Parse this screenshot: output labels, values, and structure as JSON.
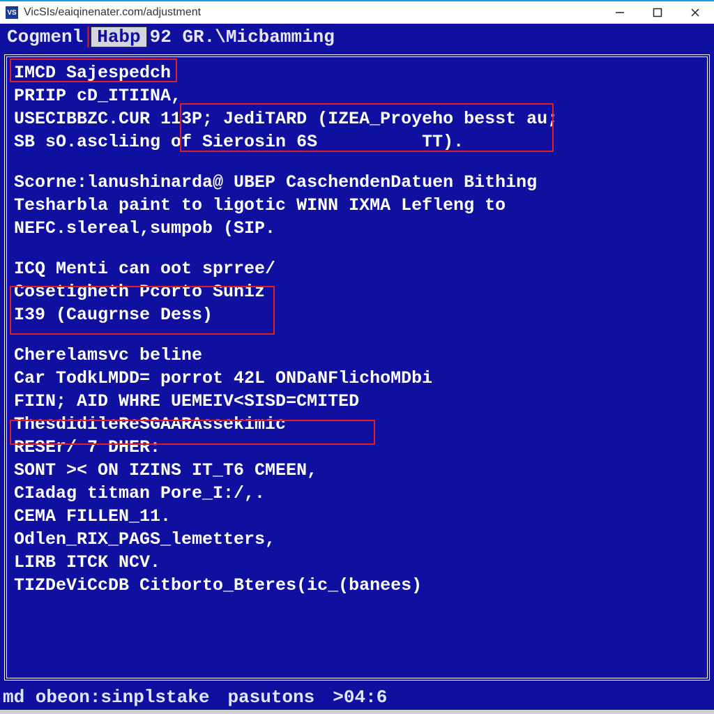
{
  "window": {
    "title": "VicSIs/eaiqinenater.com/adjustment",
    "icon_label": "VS"
  },
  "menubar": {
    "item1": "Cogmenl",
    "tab": "Habp",
    "item2": "92 GR.\\Micbamming"
  },
  "terminal": {
    "l01": "IMCD Sajespedch",
    "l02": "PRIIP cD_ITIINA,",
    "l03": "USECIBBZC.CUR 113P; JediTARD (IZEA_Proyeho besst au;",
    "l04": "SB sO.ascliing of Sierosin 6S          TT).",
    "l05": "Scorne:lanushinarda@ UBEP CaschendenDatuen Bithing",
    "l06": "Tesharbla paint to ligotic WINN IXMA Lefleng to",
    "l07": "NEFC.slereal,sumpob (SIP.",
    "l08": "ICQ Menti can oot sprree/",
    "l09": "Cosetigheth Pcorto Suniz",
    "l10": "I39 (Caugrnse Dess)",
    "l11": "Cherelamsvc beline",
    "l12": "Car TodkLMDD= porrot 42L ONDaNFlichoMDbi",
    "l13": "FIIN; AID WHRE UEMEIV<SISD=CMITED",
    "l14": "ThesdidileReSGAARAssekimic",
    "l15": "RESEr/ 7 DHER:",
    "l16": "SONT >< ON IZINS IT_T6 CMEEN,",
    "l17": "CIadag titman Pore_I:/,.",
    "l18": "CEMA FILLEN_11.",
    "l19": "Odlen_RIX_PAGS_lemetters,",
    "l20": "LIRB ITCK NCV.",
    "l21": "TIZDeViCcDB Citborto_Bteres(ic_(banees)"
  },
  "status": {
    "left": "md obeon:sinplstake",
    "mid": "pasutons",
    "right": ">04:6"
  },
  "colors": {
    "bg": "#1010a0",
    "fg": "#ffffff",
    "highlight": "#e02020",
    "chrome_accent": "#1a9adf"
  }
}
